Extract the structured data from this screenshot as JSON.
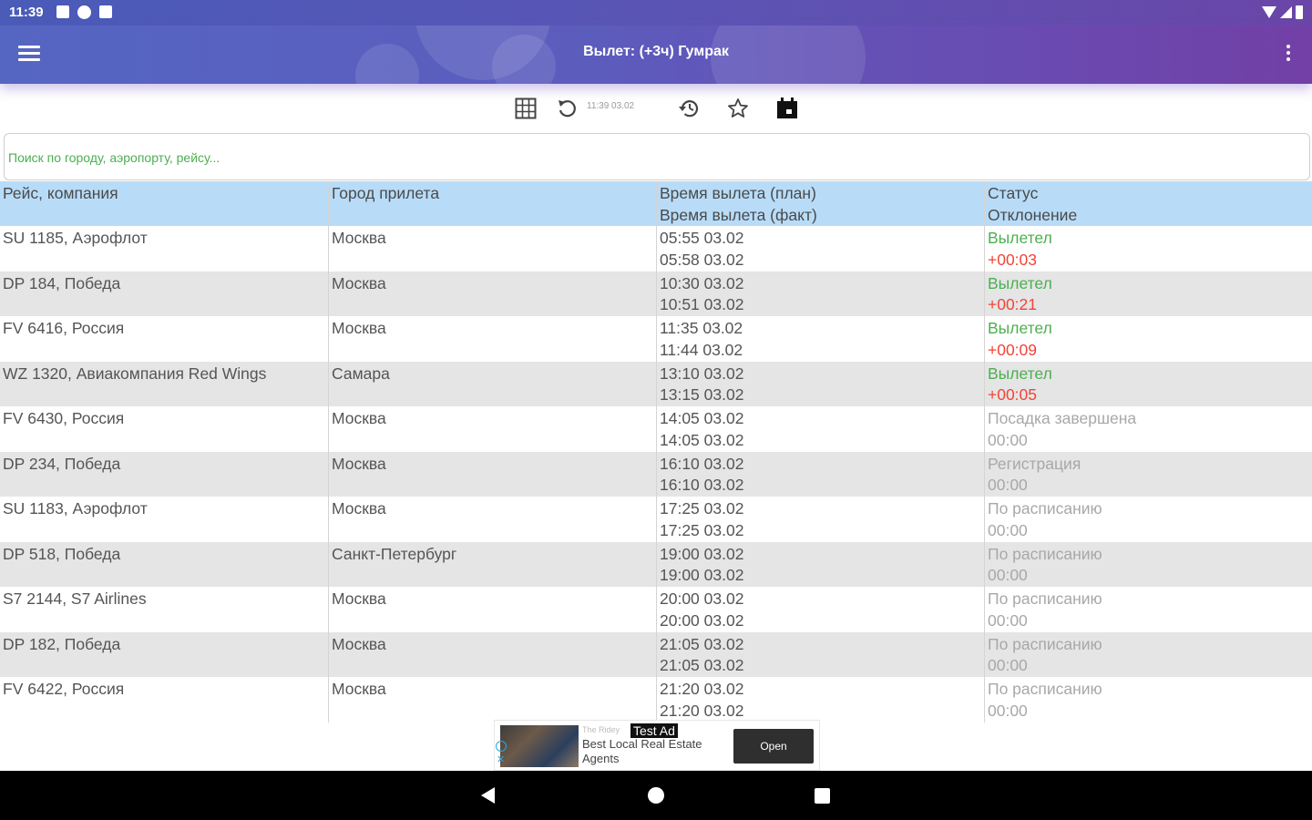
{
  "status_bar": {
    "time": "11:39"
  },
  "app_bar": {
    "title": "Вылет: (+3ч) Гумрак"
  },
  "toolbar": {
    "timestamp": "11:39 03.02"
  },
  "search": {
    "placeholder": "Поиск по городу, аэропорту, рейсу..."
  },
  "table": {
    "headers": {
      "flight": "Рейс, компания",
      "city": "Город прилета",
      "time_plan": "Время вылета (план)",
      "time_fact": "Время вылета (факт)",
      "status": "Статус",
      "deviation": "Отклонение"
    },
    "rows": [
      {
        "flight": "SU 1185, Аэрофлот",
        "city": "Москва",
        "plan": "05:55 03.02",
        "fact": "05:58 03.02",
        "status": "Вылетел",
        "delta": "+00:03"
      },
      {
        "flight": "DP 184, Победа",
        "city": "Москва",
        "plan": "10:30 03.02",
        "fact": "10:51 03.02",
        "status": "Вылетел",
        "delta": "+00:21"
      },
      {
        "flight": "FV 6416, Россия",
        "city": "Москва",
        "plan": "11:35 03.02",
        "fact": "11:44 03.02",
        "status": "Вылетел",
        "delta": "+00:09"
      },
      {
        "flight": "WZ 1320, Авиакомпания Red Wings",
        "city": "Самара",
        "plan": "13:10 03.02",
        "fact": "13:15 03.02",
        "status": "Вылетел",
        "delta": "+00:05"
      },
      {
        "flight": "FV 6430, Россия",
        "city": "Москва",
        "plan": "14:05 03.02",
        "fact": "14:05 03.02",
        "status": "Посадка завершена",
        "delta": "00:00"
      },
      {
        "flight": "DP 234, Победа",
        "city": "Москва",
        "plan": "16:10 03.02",
        "fact": "16:10 03.02",
        "status": "Регистрация",
        "delta": "00:00"
      },
      {
        "flight": "SU 1183, Аэрофлот",
        "city": "Москва",
        "plan": "17:25 03.02",
        "fact": "17:25 03.02",
        "status": "По расписанию",
        "delta": "00:00"
      },
      {
        "flight": "DP 518, Победа",
        "city": "Санкт-Петербург",
        "plan": "19:00 03.02",
        "fact": "19:00 03.02",
        "status": "По расписанию",
        "delta": "00:00"
      },
      {
        "flight": "S7 2144, S7 Airlines",
        "city": "Москва",
        "plan": "20:00 03.02",
        "fact": "20:00 03.02",
        "status": "По расписанию",
        "delta": "00:00"
      },
      {
        "flight": "DP 182, Победа",
        "city": "Москва",
        "plan": "21:05 03.02",
        "fact": "21:05 03.02",
        "status": "По расписанию",
        "delta": "00:00"
      },
      {
        "flight": "FV 6422, Россия",
        "city": "Москва",
        "plan": "21:20 03.02",
        "fact": "21:20 03.02",
        "status": "По расписанию",
        "delta": "00:00"
      }
    ]
  },
  "ad": {
    "brand": "The Ridey",
    "label": "Test Ad",
    "text": "Best Local Real Estate Agents",
    "button": "Open"
  },
  "icons": {
    "toolbar": [
      "grid-icon",
      "refresh-icon",
      "history-icon",
      "star-icon",
      "calendar-icon"
    ]
  },
  "colors": {
    "status_departed": "#4caf50",
    "status_other": "#a8a8a8",
    "delta_late": "#f44336",
    "header_bg": "#b8dcf8",
    "row_alt_bg": "#e5e5e5"
  }
}
